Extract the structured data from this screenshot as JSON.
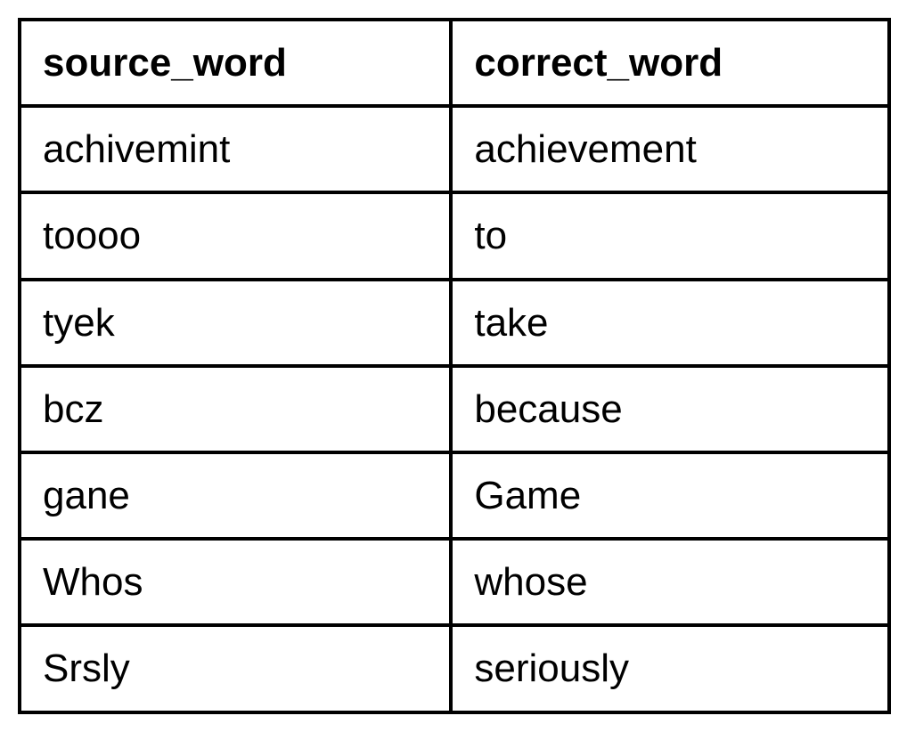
{
  "chart_data": {
    "type": "table",
    "columns": [
      "source_word",
      "correct_word"
    ],
    "rows": [
      [
        "achivemint",
        "achievement"
      ],
      [
        "toooo",
        "to"
      ],
      [
        "tyek",
        "take"
      ],
      [
        "bcz",
        "because"
      ],
      [
        "gane",
        "Game"
      ],
      [
        "Whos",
        "whose"
      ],
      [
        "Srsly",
        "seriously"
      ]
    ]
  },
  "headers": {
    "col0": "source_word",
    "col1": "correct_word"
  },
  "rows": [
    {
      "col0": "achivemint",
      "col1": "achievement"
    },
    {
      "col0": "toooo",
      "col1": "to"
    },
    {
      "col0": "tyek",
      "col1": "take"
    },
    {
      "col0": "bcz",
      "col1": "because"
    },
    {
      "col0": "gane",
      "col1": "Game"
    },
    {
      "col0": "Whos",
      "col1": "whose"
    },
    {
      "col0": "Srsly",
      "col1": "seriously"
    }
  ]
}
